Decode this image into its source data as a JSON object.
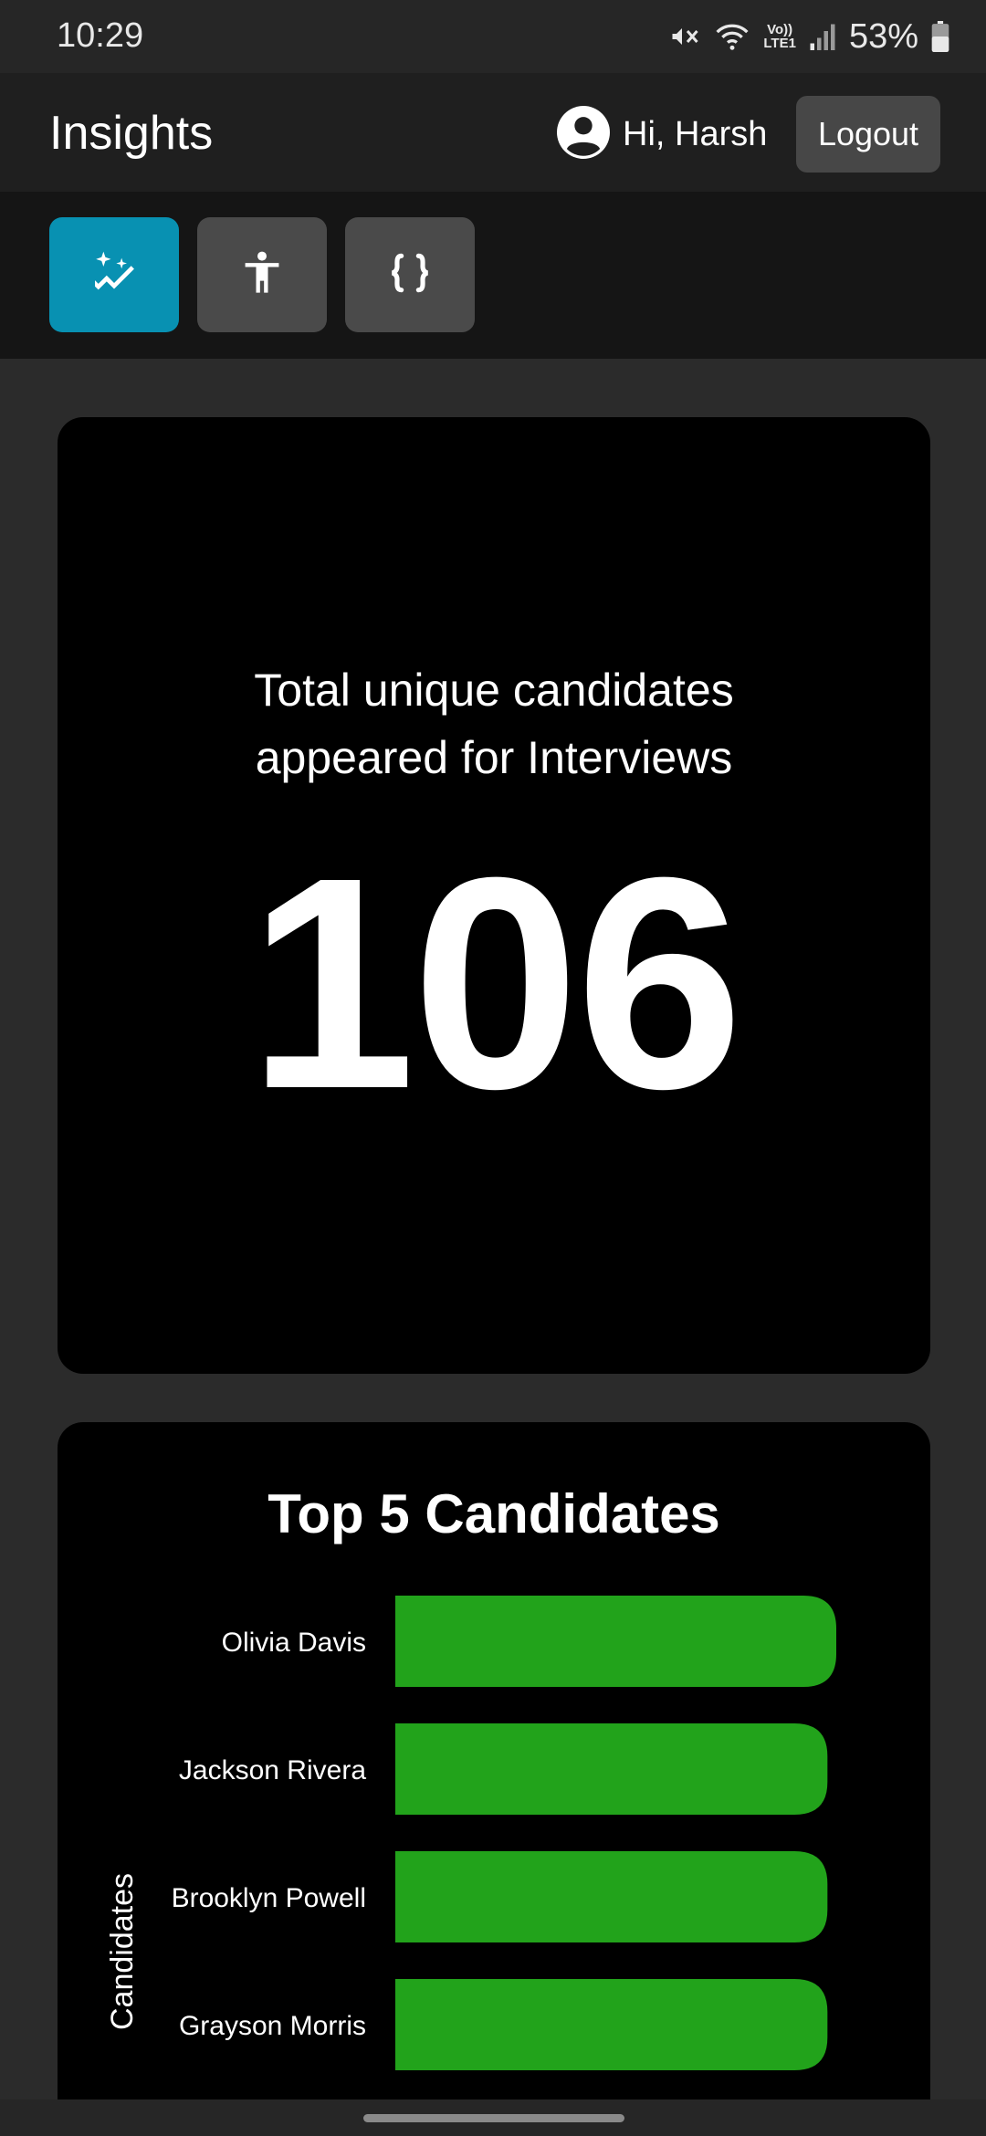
{
  "status_bar": {
    "time": "10:29",
    "volte_top": "Vo))",
    "volte_bottom": "LTE1",
    "battery": "53%",
    "icons": [
      "mute-icon",
      "wifi-icon",
      "volte-icon",
      "signal-icon",
      "battery-icon"
    ]
  },
  "header": {
    "title": "Insights",
    "greeting": "Hi, Harsh",
    "logout_label": "Logout",
    "avatar_icon": "account-circle-icon"
  },
  "tabs": [
    {
      "icon": "insights-sparkle-icon",
      "active": true
    },
    {
      "icon": "accessibility-person-icon",
      "active": false
    },
    {
      "icon": "code-braces-icon",
      "active": false
    }
  ],
  "colors": {
    "accent": "#0891b2",
    "bar": "#22a31b",
    "background": "#2b2b2b",
    "card": "#000000"
  },
  "stat_card": {
    "label_line1": "Total unique candidates",
    "label_line2": "appeared for Interviews",
    "value": "106"
  },
  "chart_data": {
    "type": "bar",
    "orientation": "horizontal",
    "title": "Top 5 Candidates",
    "ylabel": "Candidates",
    "xlabel": "",
    "categories": [
      "Olivia Davis",
      "Jackson Rivera",
      "Brooklyn Powell",
      "Grayson Morris"
    ],
    "values": [
      1.0,
      0.98,
      0.98,
      0.98
    ],
    "xlim": [
      0,
      1.0
    ]
  }
}
